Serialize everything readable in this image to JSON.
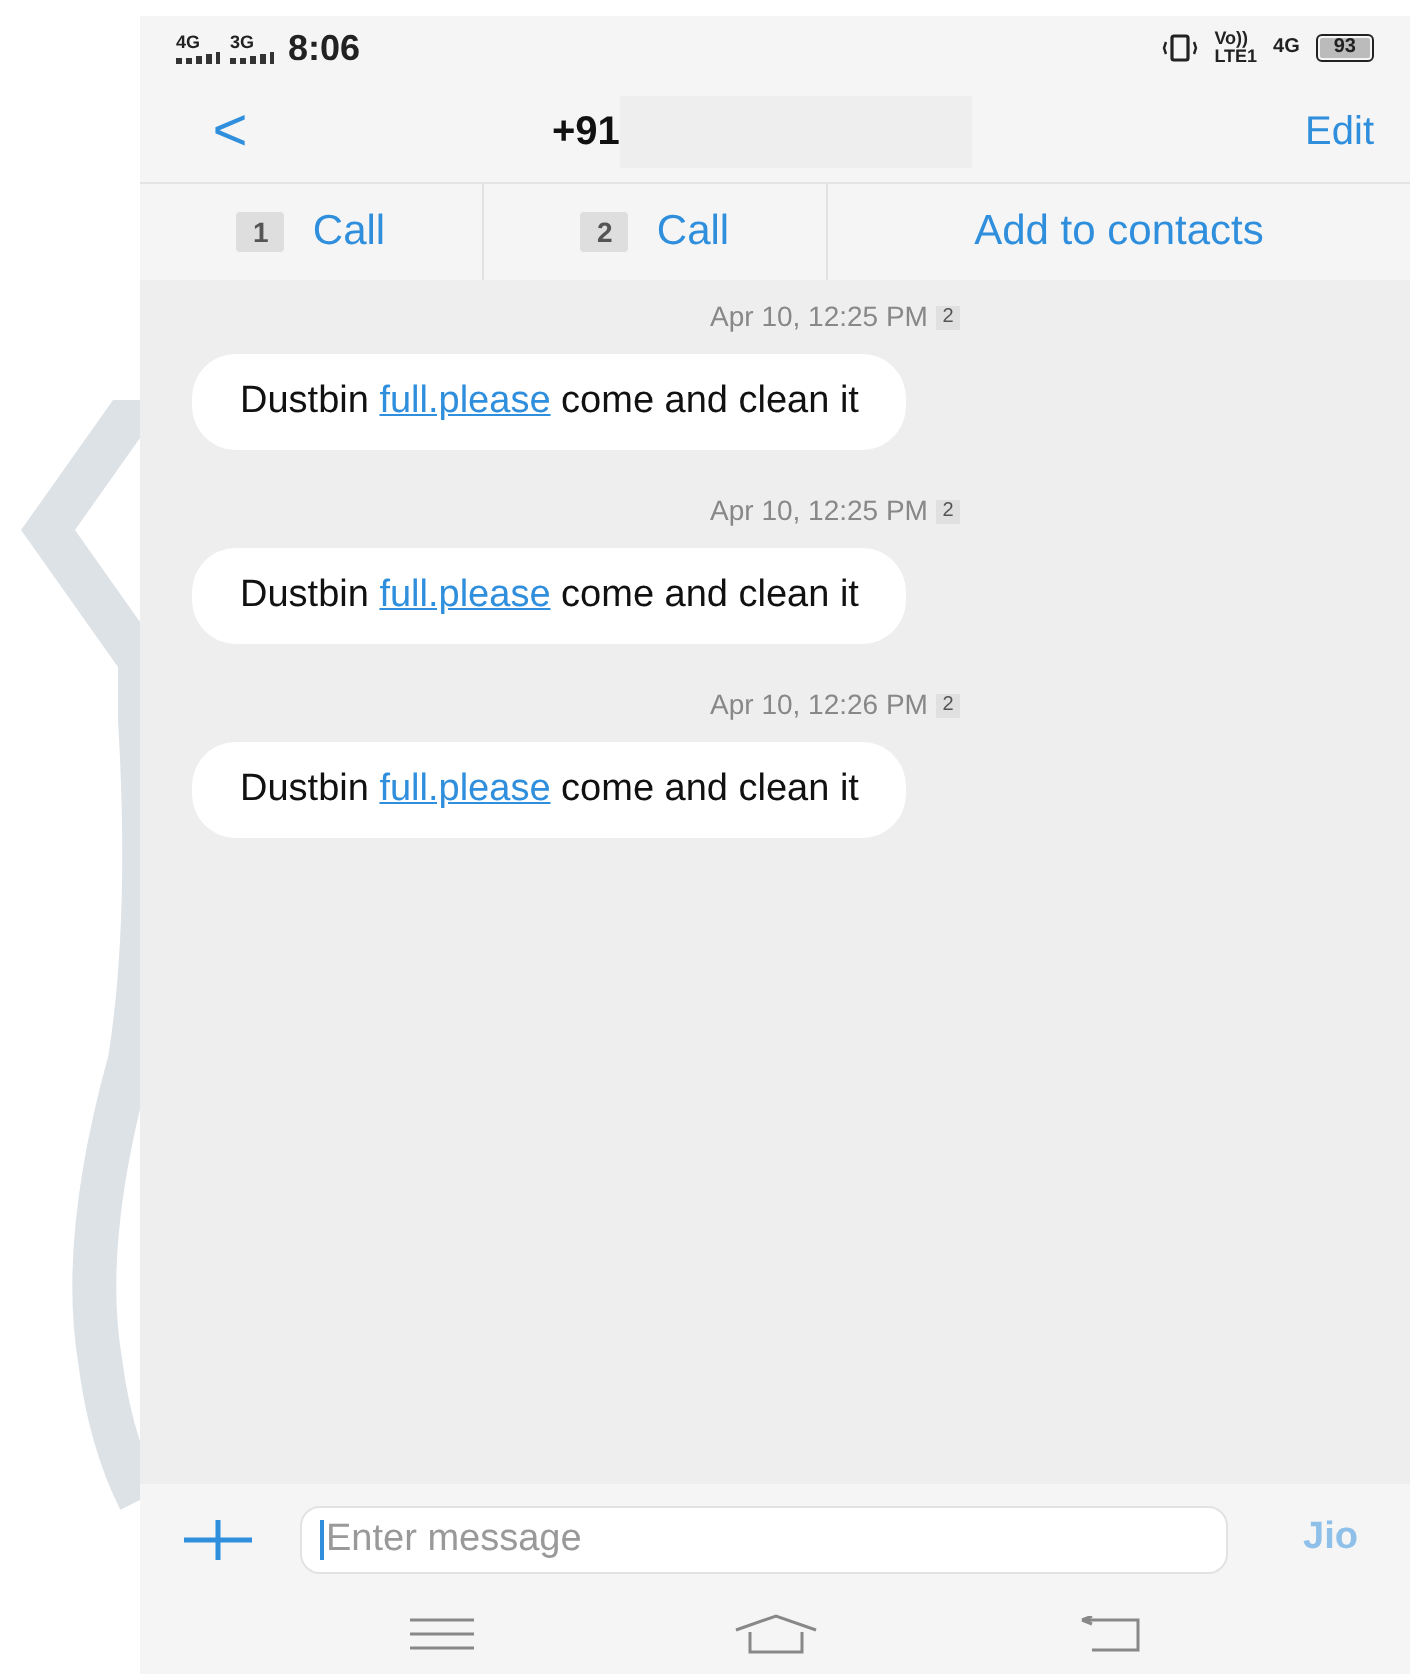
{
  "status_bar": {
    "network_1": "4G",
    "network_2": "3G",
    "time": "8:06",
    "volte": "Vo))",
    "lte": "LTE1",
    "data": "4G",
    "battery": "93"
  },
  "header": {
    "back": "<",
    "title": "+91",
    "edit": "Edit"
  },
  "actions": [
    {
      "sim": "1",
      "label": "Call"
    },
    {
      "sim": "2",
      "label": "Call"
    },
    {
      "label": "Add to contacts"
    }
  ],
  "messages": [
    {
      "time": "Apr 10, 12:25 PM",
      "sim": "2",
      "before": "Dustbin ",
      "link": "full.please",
      "after": " come and clean it"
    },
    {
      "time": "Apr 10, 12:25 PM",
      "sim": "2",
      "before": "Dustbin ",
      "link": "full.please",
      "after": " come and clean it"
    },
    {
      "time": "Apr 10, 12:26 PM",
      "sim": "2",
      "before": "Dustbin ",
      "link": "full.please",
      "after": " come and clean it"
    }
  ],
  "composer": {
    "placeholder": "Enter message",
    "carrier": "Jio"
  }
}
